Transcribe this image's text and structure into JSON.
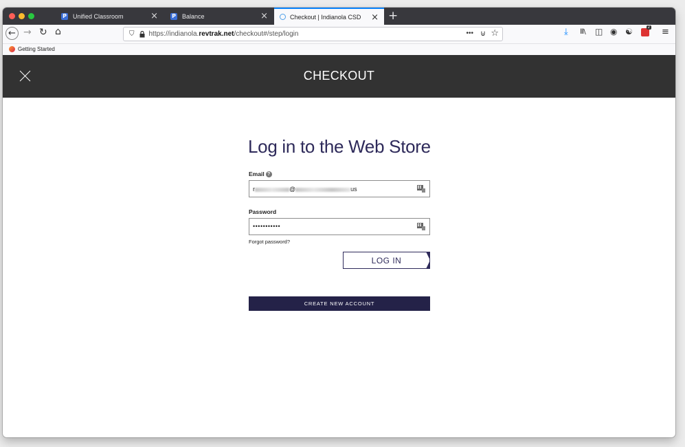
{
  "browser": {
    "tabs": [
      {
        "label": "Unified Classroom",
        "icon": "p-icon"
      },
      {
        "label": "Balance",
        "icon": "p-icon"
      },
      {
        "label": "Checkout | Indianola CSD",
        "icon": "checkout-icon",
        "active": true
      }
    ],
    "url": {
      "prefix": "https://indianola.",
      "host": "revtrak.net",
      "rest": "/checkout#/step/login"
    },
    "bookmark": "Getting Started",
    "traffic_colors": [
      "#fe5f57",
      "#febc2e",
      "#28c840"
    ],
    "accent": "#0a84ff",
    "extension_badge": "2"
  },
  "header": {
    "title": "CHECKOUT",
    "background": "#323232"
  },
  "login": {
    "title": "Log in to the Web Store",
    "email_label": "Email",
    "email_help_icon": "?",
    "email_value_start": "r",
    "email_value_mid": "@",
    "email_value_end": "us",
    "password_label": "Password",
    "password_value": "•••••••••••",
    "forgot_link": "Forgot password?",
    "login_button": "LOG IN",
    "create_button": "CREATE NEW ACCOUNT",
    "brand_color": "#2e2a5a"
  }
}
